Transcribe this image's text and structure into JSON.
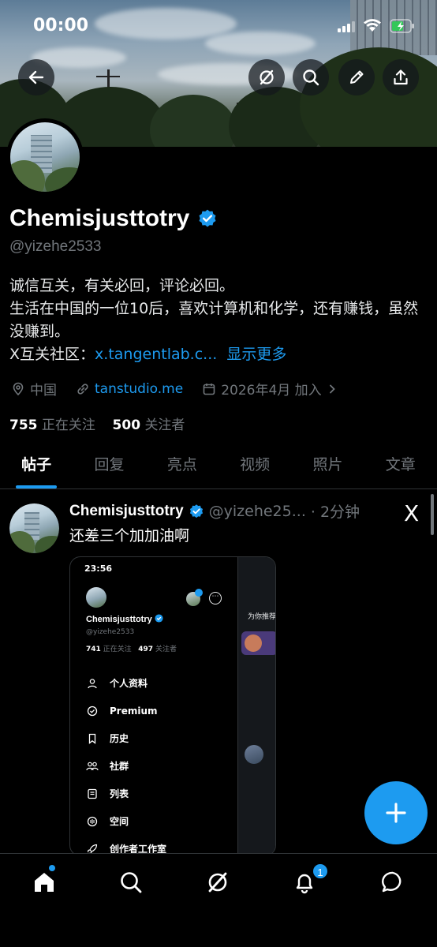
{
  "status_bar": {
    "time": "00:00"
  },
  "profile": {
    "display_name": "Chemisjusttotry",
    "handle": "@yizehe2533",
    "bio_line1": "诚信互关，有关必回，评论必回。",
    "bio_line2": "生活在中国的一位10后，喜欢计算机和化学，还有赚钱，虽然没赚到。",
    "bio_line3_prefix": "X互关社区：",
    "bio_link": "x.tangentlab.c...",
    "show_more": "显示更多",
    "location": "中国",
    "website": "tanstudio.me",
    "joined": "2026年4月 加入",
    "following_count": "755",
    "following_label": "正在关注",
    "followers_count": "500",
    "followers_label": "关注者"
  },
  "tabs": [
    {
      "label": "帖子",
      "active": true
    },
    {
      "label": "回复"
    },
    {
      "label": "亮点"
    },
    {
      "label": "视频"
    },
    {
      "label": "照片"
    },
    {
      "label": "文章"
    }
  ],
  "post": {
    "author": "Chemisjusttotry",
    "handle": "@yizehe25...",
    "time": "· 2分钟",
    "text": "还差三个加加油啊",
    "badge_logo": "X"
  },
  "embedded_screenshot": {
    "time": "23:56",
    "name": "Chemisjusttotry",
    "handle": "@yizehe2533",
    "following_count": "741",
    "following_label": "正在关注",
    "followers_count": "497",
    "followers_label": "关注者",
    "side_tab": "为你推荐",
    "menu": [
      {
        "label": "个人资料",
        "icon": "person-icon"
      },
      {
        "label": "Premium",
        "icon": "premium-icon"
      },
      {
        "label": "历史",
        "icon": "bookmark-icon"
      },
      {
        "label": "社群",
        "icon": "communities-icon"
      },
      {
        "label": "列表",
        "icon": "list-icon"
      },
      {
        "label": "空间",
        "icon": "spaces-icon"
      },
      {
        "label": "创作者工作室",
        "icon": "rocket-icon"
      }
    ]
  },
  "bottom_nav": {
    "notifications_badge": "1",
    "items": [
      "home-icon",
      "search-icon",
      "grok-icon",
      "notifications-icon",
      "messages-icon"
    ]
  },
  "colors": {
    "accent": "#1d9bf0",
    "background": "#000000",
    "secondary_text": "#71767b"
  }
}
